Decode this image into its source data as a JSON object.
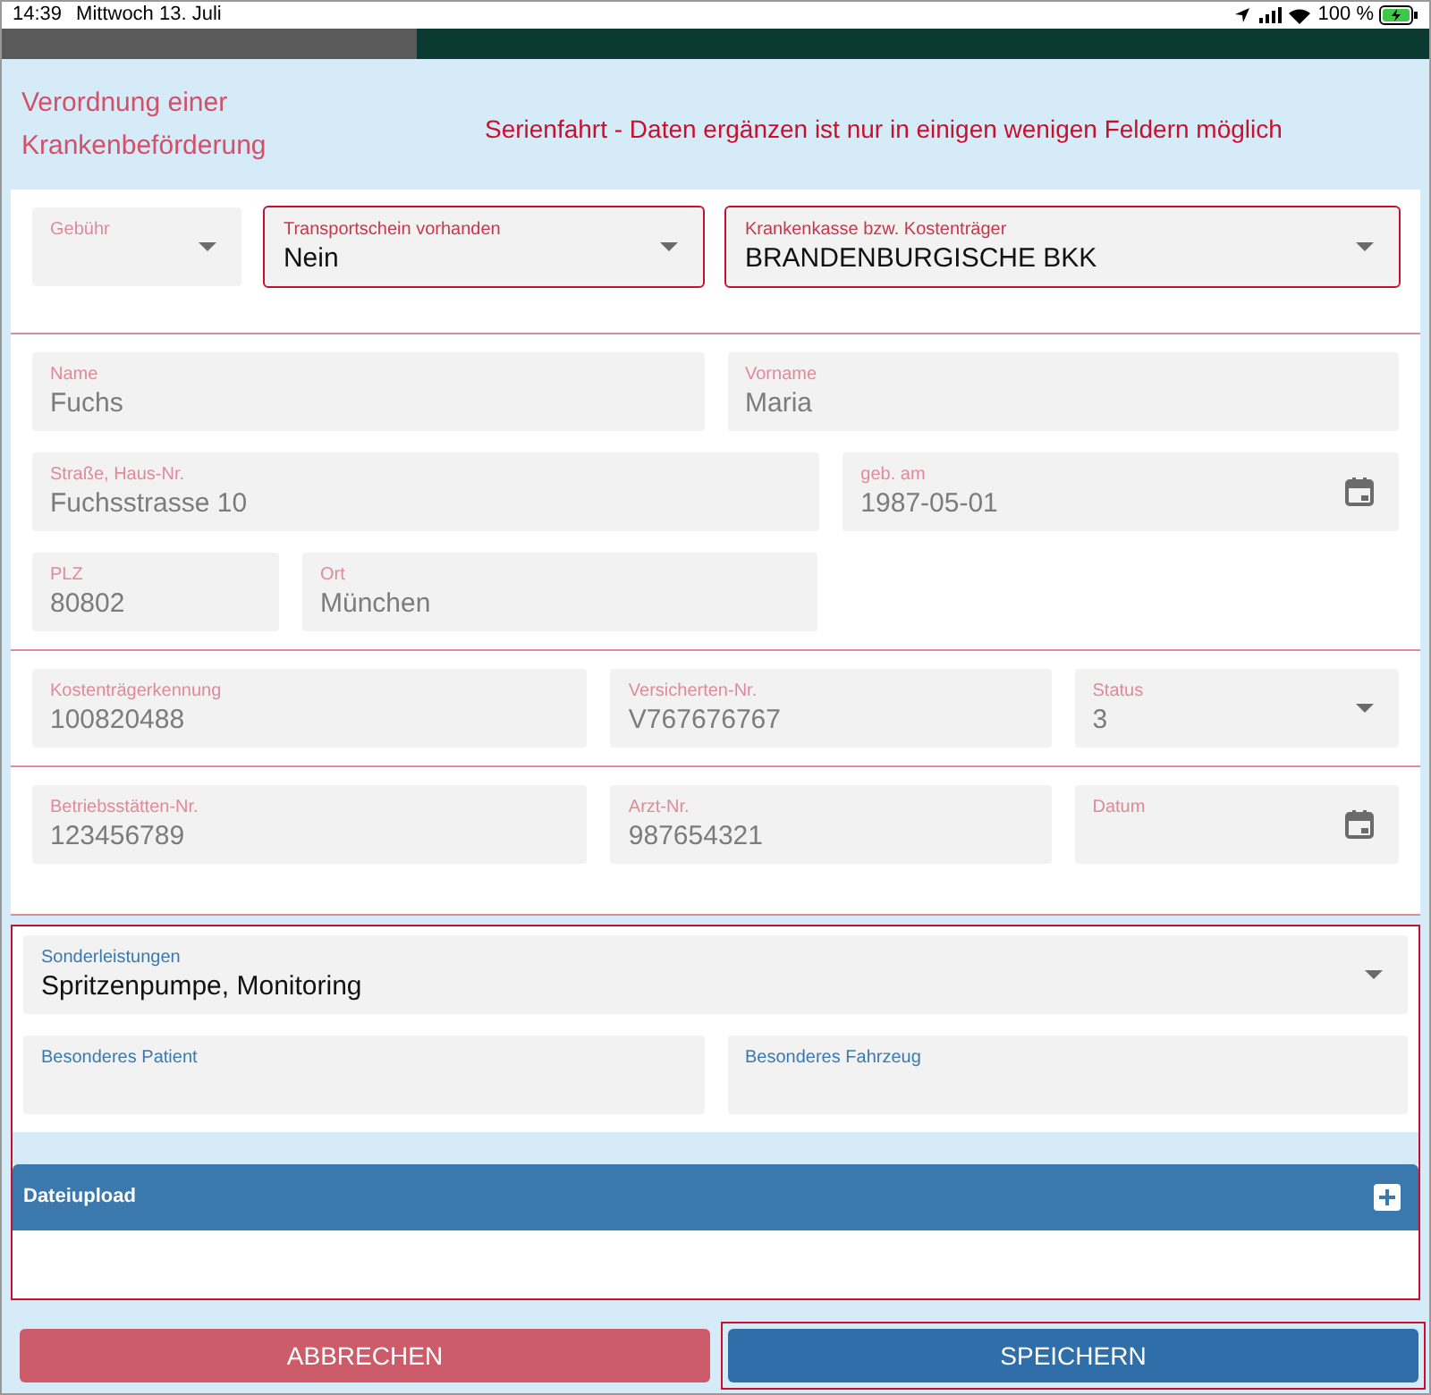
{
  "status_bar": {
    "time": "14:39",
    "date": "Mittwoch 13. Juli",
    "battery": "100 %"
  },
  "header": {
    "title": "Verordnung einer Krankenbeförderung",
    "notice": "Serienfahrt - Daten ergänzen ist nur in einigen wenigen Feldern möglich"
  },
  "sections": [
    {
      "rows": [
        [
          {
            "label": "Gebühr",
            "kind": "select",
            "disabled": true,
            "required": false
          },
          {
            "label": "Transportschein vorhanden",
            "value": "Nein",
            "kind": "select",
            "disabled": false,
            "required": true
          },
          {
            "label": "Krankenkasse bzw. Kostenträger",
            "value": "BRANDENBURGISCHE BKK",
            "kind": "select",
            "disabled": false,
            "required": true
          }
        ]
      ]
    },
    {
      "rows": [
        [
          {
            "label": "Name",
            "value": "Fuchs",
            "kind": "text",
            "disabled": true,
            "required": false
          },
          {
            "label": "Vorname",
            "value": "Maria",
            "kind": "text",
            "disabled": true,
            "required": false
          }
        ],
        [
          {
            "label": "Straße, Haus-Nr.",
            "value": "Fuchsstrasse 10",
            "kind": "text",
            "disabled": true,
            "required": false
          },
          {
            "label": "geb. am",
            "value": "1987-05-01",
            "kind": "date",
            "disabled": true,
            "required": false
          }
        ],
        [
          {
            "label": "PLZ",
            "value": "80802",
            "kind": "text",
            "disabled": true,
            "required": false
          },
          {
            "label": "Ort",
            "value": "München",
            "kind": "text",
            "disabled": true,
            "required": false
          }
        ]
      ]
    },
    {
      "rows": [
        [
          {
            "label": "Kostenträgerkennung",
            "value": "100820488",
            "kind": "text",
            "disabled": true,
            "required": false
          },
          {
            "label": "Versicherten-Nr.",
            "value": "V767676767",
            "kind": "text",
            "disabled": true,
            "required": false
          },
          {
            "label": "Status",
            "value": "3",
            "kind": "select",
            "disabled": true,
            "required": false
          }
        ]
      ]
    },
    {
      "rows": [
        [
          {
            "label": "Betriebsstätten-Nr.",
            "value": "123456789",
            "kind": "text",
            "disabled": true,
            "required": false
          },
          {
            "label": "Arzt-Nr.",
            "value": "987654321",
            "kind": "text",
            "disabled": true,
            "required": false
          },
          {
            "label": "Datum",
            "kind": "date",
            "disabled": true,
            "required": false
          }
        ]
      ]
    }
  ],
  "editable_section": {
    "rows": [
      [
        {
          "label": "Sonderleistungen",
          "value": "Spritzenpumpe, Monitoring",
          "kind": "select",
          "disabled": false,
          "required": false
        }
      ],
      [
        {
          "label": "Besonderes Patient",
          "kind": "text",
          "disabled": false,
          "required": false
        },
        {
          "label": "Besonderes Fahrzeug",
          "kind": "text",
          "disabled": false,
          "required": false
        }
      ]
    ],
    "upload": {
      "title": "Dateiupload"
    }
  },
  "buttons": [
    {
      "label": "ABBRECHEN",
      "kind": "cancel",
      "focused": false
    },
    {
      "label": "SPEICHERN",
      "kind": "save",
      "focused": true
    }
  ]
}
